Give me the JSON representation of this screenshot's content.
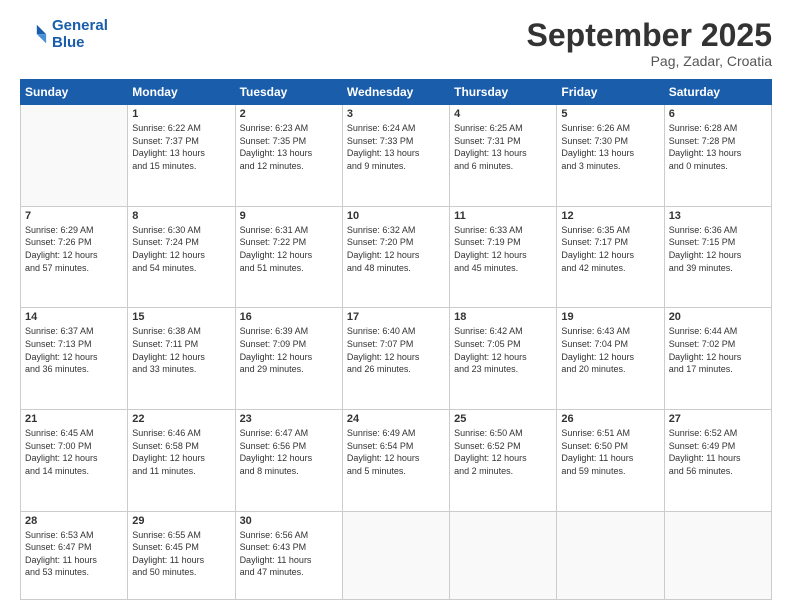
{
  "logo": {
    "line1": "General",
    "line2": "Blue"
  },
  "header": {
    "month": "September 2025",
    "location": "Pag, Zadar, Croatia"
  },
  "weekdays": [
    "Sunday",
    "Monday",
    "Tuesday",
    "Wednesday",
    "Thursday",
    "Friday",
    "Saturday"
  ],
  "rows": [
    [
      {
        "day": "",
        "info": ""
      },
      {
        "day": "1",
        "info": "Sunrise: 6:22 AM\nSunset: 7:37 PM\nDaylight: 13 hours\nand 15 minutes."
      },
      {
        "day": "2",
        "info": "Sunrise: 6:23 AM\nSunset: 7:35 PM\nDaylight: 13 hours\nand 12 minutes."
      },
      {
        "day": "3",
        "info": "Sunrise: 6:24 AM\nSunset: 7:33 PM\nDaylight: 13 hours\nand 9 minutes."
      },
      {
        "day": "4",
        "info": "Sunrise: 6:25 AM\nSunset: 7:31 PM\nDaylight: 13 hours\nand 6 minutes."
      },
      {
        "day": "5",
        "info": "Sunrise: 6:26 AM\nSunset: 7:30 PM\nDaylight: 13 hours\nand 3 minutes."
      },
      {
        "day": "6",
        "info": "Sunrise: 6:28 AM\nSunset: 7:28 PM\nDaylight: 13 hours\nand 0 minutes."
      }
    ],
    [
      {
        "day": "7",
        "info": "Sunrise: 6:29 AM\nSunset: 7:26 PM\nDaylight: 12 hours\nand 57 minutes."
      },
      {
        "day": "8",
        "info": "Sunrise: 6:30 AM\nSunset: 7:24 PM\nDaylight: 12 hours\nand 54 minutes."
      },
      {
        "day": "9",
        "info": "Sunrise: 6:31 AM\nSunset: 7:22 PM\nDaylight: 12 hours\nand 51 minutes."
      },
      {
        "day": "10",
        "info": "Sunrise: 6:32 AM\nSunset: 7:20 PM\nDaylight: 12 hours\nand 48 minutes."
      },
      {
        "day": "11",
        "info": "Sunrise: 6:33 AM\nSunset: 7:19 PM\nDaylight: 12 hours\nand 45 minutes."
      },
      {
        "day": "12",
        "info": "Sunrise: 6:35 AM\nSunset: 7:17 PM\nDaylight: 12 hours\nand 42 minutes."
      },
      {
        "day": "13",
        "info": "Sunrise: 6:36 AM\nSunset: 7:15 PM\nDaylight: 12 hours\nand 39 minutes."
      }
    ],
    [
      {
        "day": "14",
        "info": "Sunrise: 6:37 AM\nSunset: 7:13 PM\nDaylight: 12 hours\nand 36 minutes."
      },
      {
        "day": "15",
        "info": "Sunrise: 6:38 AM\nSunset: 7:11 PM\nDaylight: 12 hours\nand 33 minutes."
      },
      {
        "day": "16",
        "info": "Sunrise: 6:39 AM\nSunset: 7:09 PM\nDaylight: 12 hours\nand 29 minutes."
      },
      {
        "day": "17",
        "info": "Sunrise: 6:40 AM\nSunset: 7:07 PM\nDaylight: 12 hours\nand 26 minutes."
      },
      {
        "day": "18",
        "info": "Sunrise: 6:42 AM\nSunset: 7:05 PM\nDaylight: 12 hours\nand 23 minutes."
      },
      {
        "day": "19",
        "info": "Sunrise: 6:43 AM\nSunset: 7:04 PM\nDaylight: 12 hours\nand 20 minutes."
      },
      {
        "day": "20",
        "info": "Sunrise: 6:44 AM\nSunset: 7:02 PM\nDaylight: 12 hours\nand 17 minutes."
      }
    ],
    [
      {
        "day": "21",
        "info": "Sunrise: 6:45 AM\nSunset: 7:00 PM\nDaylight: 12 hours\nand 14 minutes."
      },
      {
        "day": "22",
        "info": "Sunrise: 6:46 AM\nSunset: 6:58 PM\nDaylight: 12 hours\nand 11 minutes."
      },
      {
        "day": "23",
        "info": "Sunrise: 6:47 AM\nSunset: 6:56 PM\nDaylight: 12 hours\nand 8 minutes."
      },
      {
        "day": "24",
        "info": "Sunrise: 6:49 AM\nSunset: 6:54 PM\nDaylight: 12 hours\nand 5 minutes."
      },
      {
        "day": "25",
        "info": "Sunrise: 6:50 AM\nSunset: 6:52 PM\nDaylight: 12 hours\nand 2 minutes."
      },
      {
        "day": "26",
        "info": "Sunrise: 6:51 AM\nSunset: 6:50 PM\nDaylight: 11 hours\nand 59 minutes."
      },
      {
        "day": "27",
        "info": "Sunrise: 6:52 AM\nSunset: 6:49 PM\nDaylight: 11 hours\nand 56 minutes."
      }
    ],
    [
      {
        "day": "28",
        "info": "Sunrise: 6:53 AM\nSunset: 6:47 PM\nDaylight: 11 hours\nand 53 minutes."
      },
      {
        "day": "29",
        "info": "Sunrise: 6:55 AM\nSunset: 6:45 PM\nDaylight: 11 hours\nand 50 minutes."
      },
      {
        "day": "30",
        "info": "Sunrise: 6:56 AM\nSunset: 6:43 PM\nDaylight: 11 hours\nand 47 minutes."
      },
      {
        "day": "",
        "info": ""
      },
      {
        "day": "",
        "info": ""
      },
      {
        "day": "",
        "info": ""
      },
      {
        "day": "",
        "info": ""
      }
    ]
  ]
}
